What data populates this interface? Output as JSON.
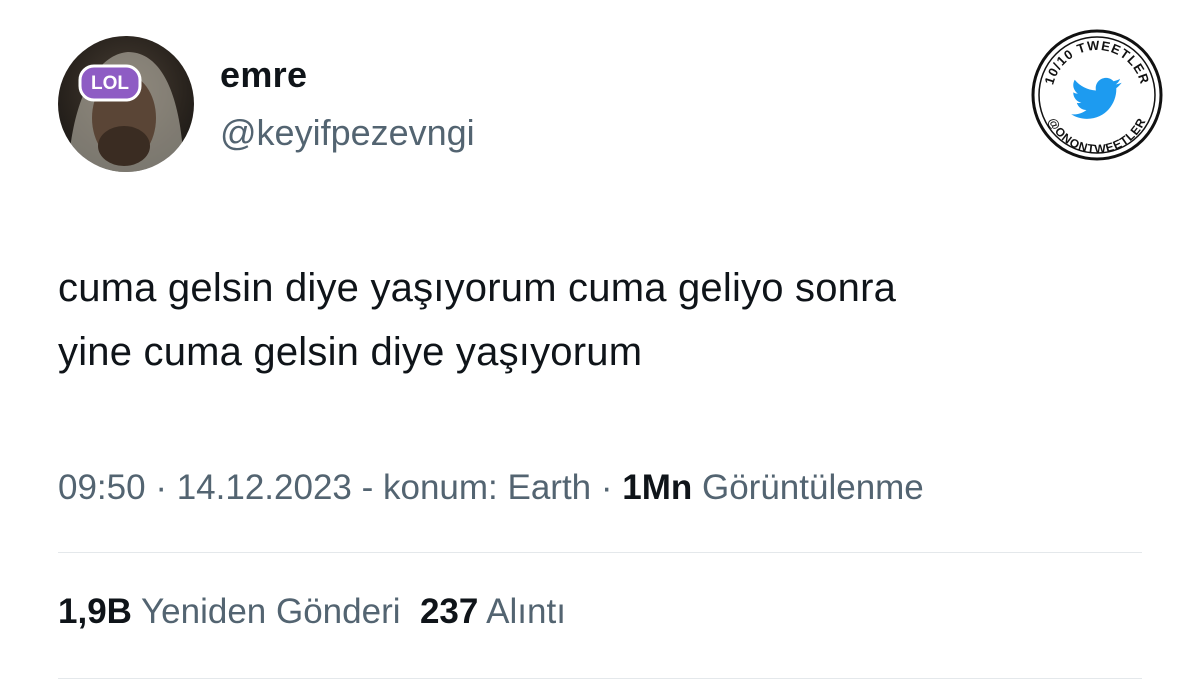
{
  "user": {
    "display_name": "emre",
    "handle": "@keyifpezevngi",
    "avatar_sticker_text": "LOL"
  },
  "badge": {
    "top_text": "10/10 TWEETLER",
    "bottom_text": "@ONONTWEETLER",
    "icon": "twitter-bird-icon",
    "accent_color": "#1d9bf0"
  },
  "tweet": {
    "lines": [
      "cuma gelsin diye yaşıyorum cuma geliyo sonra",
      "yine cuma gelsin diye yaşıyorum"
    ]
  },
  "meta": {
    "time": "09:50",
    "sep1": " · ",
    "date": "14.12.2023",
    "sep2": " - ",
    "location": "konum: Earth",
    "sep3": " · ",
    "views_count": "1Mn",
    "views_label": "Görüntülenme"
  },
  "stats": {
    "retweets_count": "1,9B",
    "retweets_label": "Yeniden Gönderi",
    "quotes_count": "237",
    "quotes_label": "Alıntı"
  }
}
